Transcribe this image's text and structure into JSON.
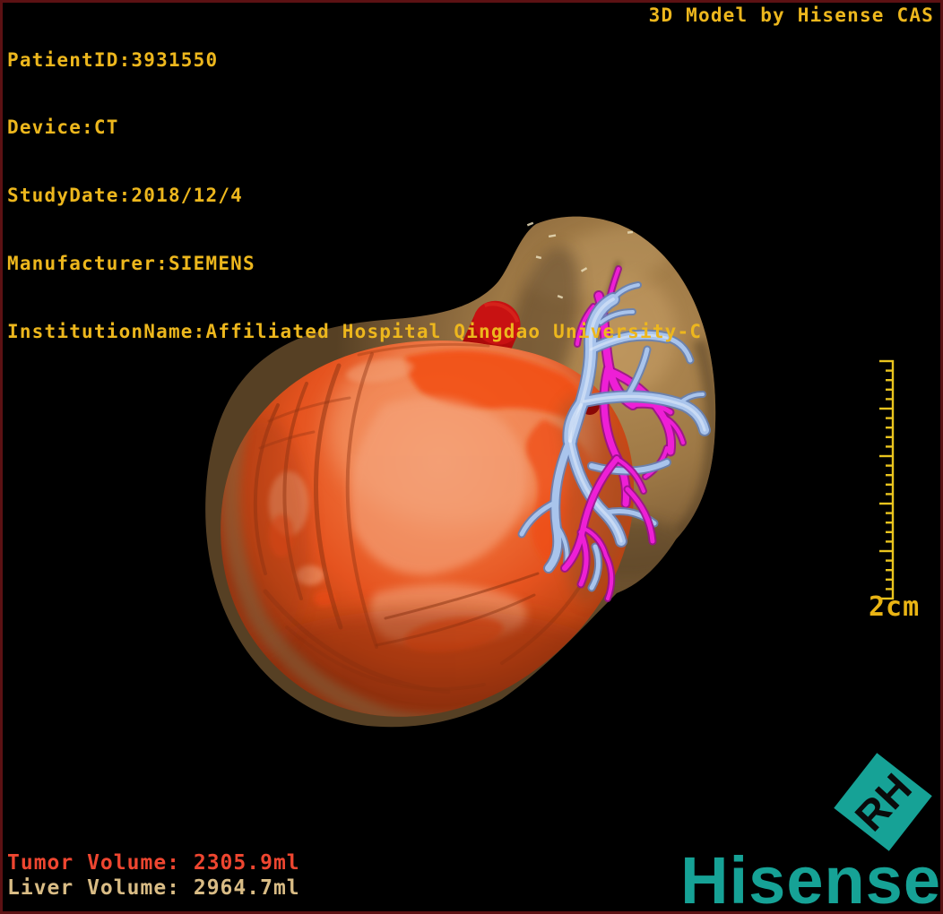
{
  "overlay": {
    "top_left_lines": [
      "PatientID:3931550",
      "Device:CT",
      "StudyDate:2018/12/4",
      "Manufacturer:SIEMENS",
      "InstitutionName:Affiliated Hospital Qingdao University-C"
    ],
    "top_right": "3D Model by Hisense CAS",
    "tumor_volume": "Tumor Volume: 2305.9ml",
    "liver_volume": "Liver Volume: 2964.7ml",
    "scale_label": "2cm"
  },
  "branding": {
    "wordmark": "Hisense",
    "badge_text": "RH"
  },
  "colors": {
    "annotation_gold": "#EDB71D",
    "tumor_text_red": "#EE4630",
    "liver_text_tan": "#D9BC85",
    "brand_teal": "#16A296",
    "frame_maroon": "#5C1113",
    "background": "#000000",
    "model_liver_tan": "#9C7748",
    "model_tumor_orange": "#EC5B28",
    "model_portal_vein_blue": "#A9C4EC",
    "model_artery_magenta": "#EE1FD6",
    "model_ivc_red": "#C90D0D"
  }
}
